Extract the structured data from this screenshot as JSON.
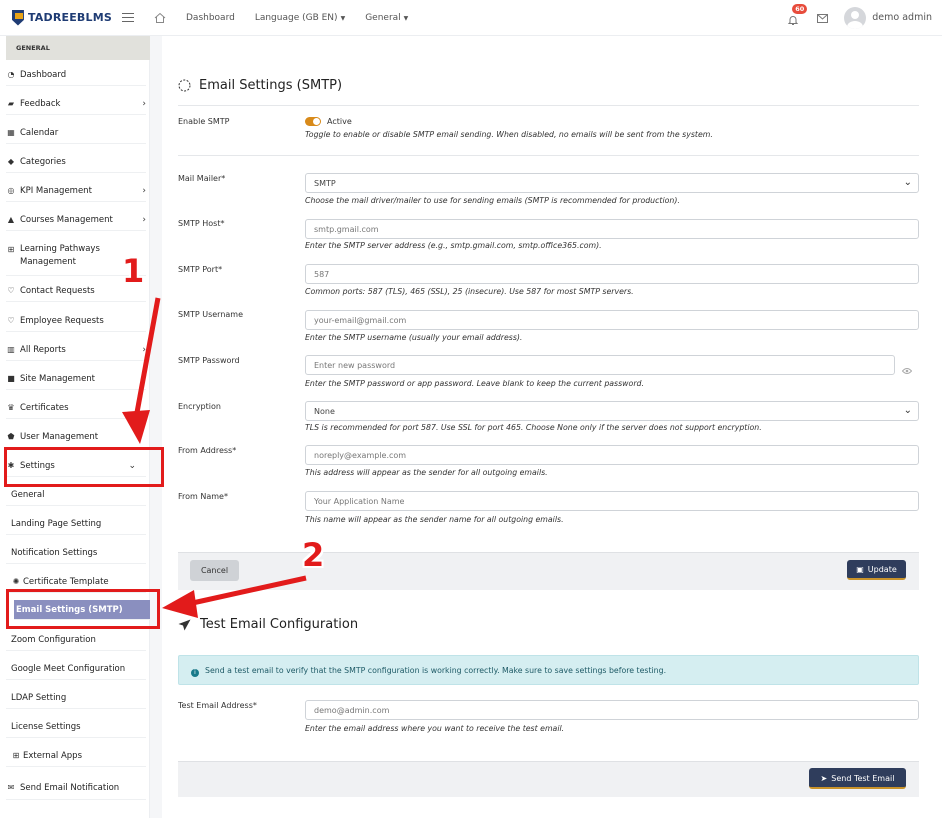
{
  "header": {
    "logo_text": "TADREEBLMS",
    "nav": [
      "Dashboard",
      "Language (GB EN)",
      "General"
    ],
    "notifications_count": "60",
    "user_name": "demo admin"
  },
  "sidebar": {
    "section_label": "GENERAL",
    "items": [
      {
        "label": "Dashboard",
        "icon": "gauge-icon"
      },
      {
        "label": "Feedback",
        "icon": "comments-icon",
        "chevron": true
      },
      {
        "label": "Calendar",
        "icon": "calendar-icon"
      },
      {
        "label": "Categories",
        "icon": "tags-icon"
      },
      {
        "label": "KPI Management",
        "icon": "target-icon",
        "chevron": true
      },
      {
        "label": "Courses Management",
        "icon": "graduation-cap-icon",
        "chevron": true
      },
      {
        "label": "Learning Pathways Management",
        "icon": "sitemap-icon"
      },
      {
        "label": "Contact Requests",
        "icon": "handshake-icon"
      },
      {
        "label": "Employee Requests",
        "icon": "handshake-icon"
      },
      {
        "label": "All Reports",
        "icon": "chart-icon",
        "chevron": true
      },
      {
        "label": "Site Management",
        "icon": "folder-icon",
        "chevron": true
      },
      {
        "label": "Certificates",
        "icon": "trophy-icon"
      },
      {
        "label": "User Management",
        "icon": "shield-icon"
      },
      {
        "label": "Settings",
        "icon": "gear-icon",
        "chevron": true
      }
    ],
    "sub_items": [
      "General",
      "Landing Page Setting",
      "Notification Settings",
      "Certificate Template",
      "Email Settings (SMTP)",
      "Zoom Configuration",
      "Google Meet Configuration",
      "LDAP Setting",
      "License Settings",
      "External Apps",
      "Send Email Notification"
    ]
  },
  "smtp": {
    "title": "Email Settings (SMTP)",
    "enable_label": "Enable SMTP",
    "enable_state": "Active",
    "enable_help": "Toggle to enable or disable SMTP email sending. When disabled, no emails will be sent from the system.",
    "mailer_label": "Mail Mailer*",
    "mailer_value": "SMTP",
    "mailer_help": "Choose the mail driver/mailer to use for sending emails (SMTP is recommended for production).",
    "host_label": "SMTP Host*",
    "host_placeholder": "smtp.gmail.com",
    "host_help": "Enter the SMTP server address (e.g., smtp.gmail.com, smtp.office365.com).",
    "port_label": "SMTP Port*",
    "port_placeholder": "587",
    "port_help": "Common ports: 587 (TLS), 465 (SSL), 25 (insecure). Use 587 for most SMTP servers.",
    "username_label": "SMTP Username",
    "username_placeholder": "your-email@gmail.com",
    "username_help": "Enter the SMTP username (usually your email address).",
    "password_label": "SMTP Password",
    "password_placeholder": "Enter new password",
    "password_help": "Enter the SMTP password or app password. Leave blank to keep the current password.",
    "encryption_label": "Encryption",
    "encryption_value": "None",
    "encryption_help": "TLS is recommended for port 587. Use SSL for port 465. Choose None only if the server does not support encryption.",
    "from_address_label": "From Address*",
    "from_address_placeholder": "noreply@example.com",
    "from_address_help": "This address will appear as the sender for all outgoing emails.",
    "from_name_label": "From Name*",
    "from_name_placeholder": "Your Application Name",
    "from_name_help": "This name will appear as the sender name for all outgoing emails.",
    "cancel_label": "Cancel",
    "update_label": "Update"
  },
  "test_email": {
    "title": "Test Email Configuration",
    "info": "Send a test email to verify that the SMTP configuration is working correctly. Make sure to save settings before testing.",
    "address_label": "Test Email Address*",
    "address_placeholder": "demo@admin.com",
    "address_help": "Enter the email address where you want to receive the test email.",
    "send_label": "Send Test Email"
  },
  "annotations": {
    "step1": "1",
    "step2": "2",
    "color": "#e21b1b"
  }
}
